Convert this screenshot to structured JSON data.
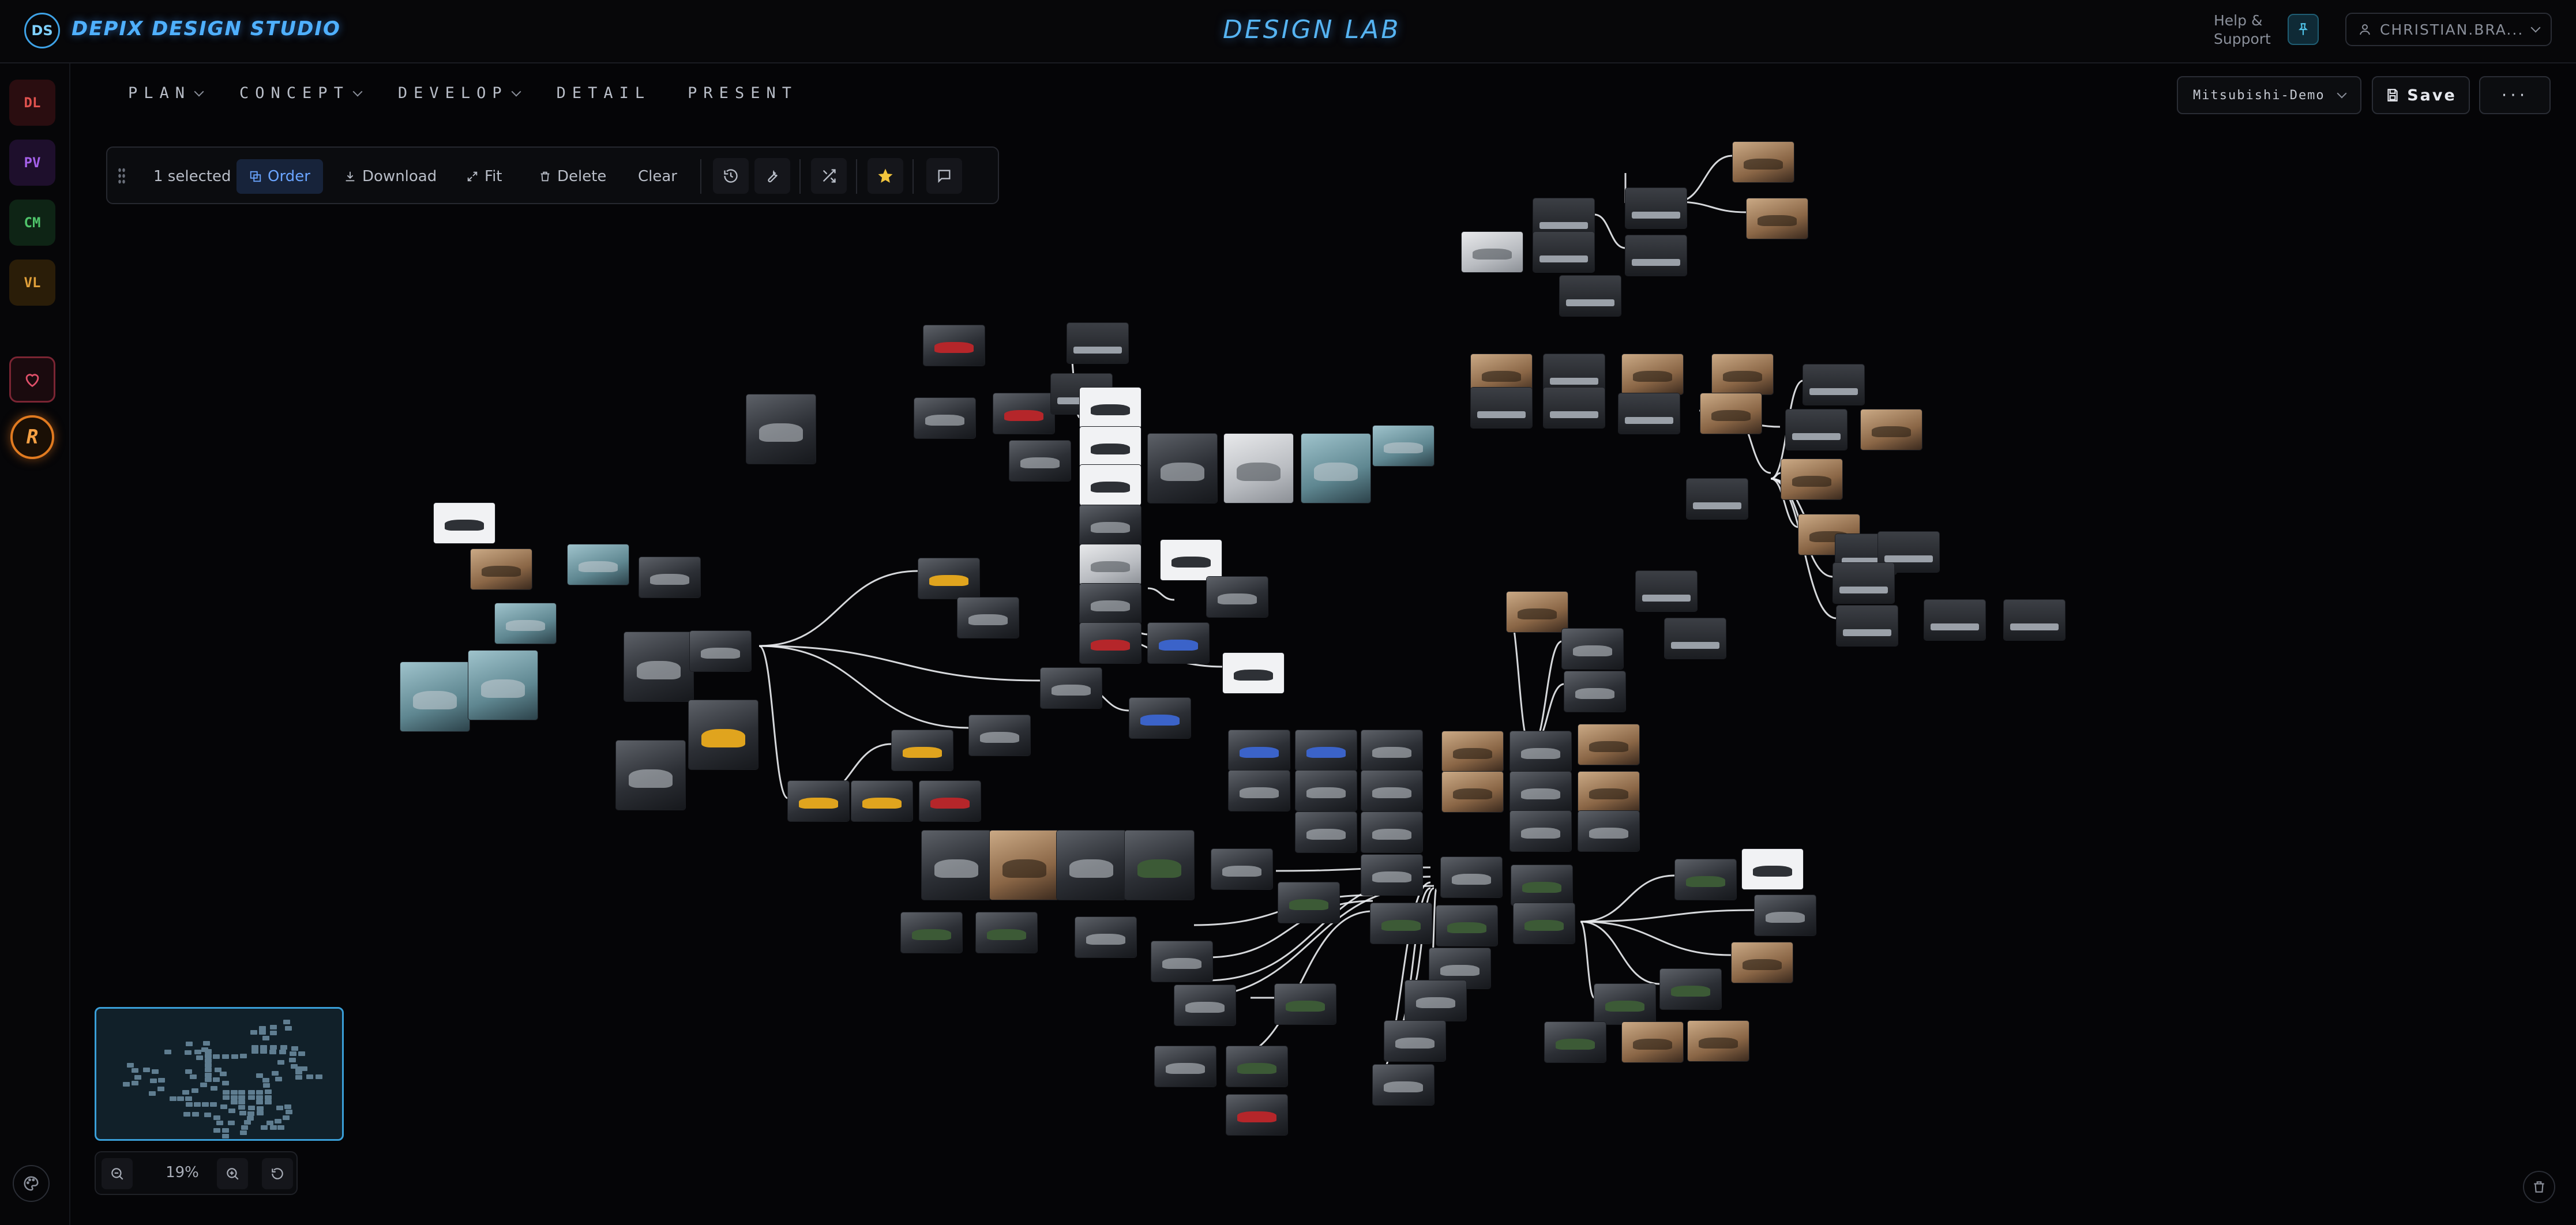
{
  "header": {
    "logo_initials": "DS",
    "brand": "DEPIX DESIGN STUDIO",
    "app_title": "DESIGN LAB",
    "help_label": "Help & Support",
    "user_label": "CHRISTIAN.BRA..."
  },
  "rail": {
    "items": [
      {
        "label": "DL",
        "color": "#e0524f"
      },
      {
        "label": "PV",
        "color": "#a460e8"
      },
      {
        "label": "CM",
        "color": "#4fc36a"
      },
      {
        "label": "VL",
        "color": "#e0a03a"
      }
    ],
    "avatar_letter": "R"
  },
  "stages": [
    {
      "label": "PLAN",
      "has_menu": true
    },
    {
      "label": "CONCEPT",
      "has_menu": true
    },
    {
      "label": "DEVELOP",
      "has_menu": true
    },
    {
      "label": "DETAIL",
      "has_menu": false
    },
    {
      "label": "PRESENT",
      "has_menu": false
    }
  ],
  "project": {
    "selected": "Mitsubishi-Demo",
    "save_label": "Save",
    "more_label": "···"
  },
  "toolbar": {
    "selection": "1 selected",
    "order": "Order",
    "download": "Download",
    "fit": "Fit",
    "delete": "Delete",
    "clear": "Clear"
  },
  "zoom": {
    "value": "19%"
  },
  "colors": {
    "accent": "#3ea2e6",
    "highlight": "#6aa4ff",
    "avatar": "#e07a20"
  }
}
